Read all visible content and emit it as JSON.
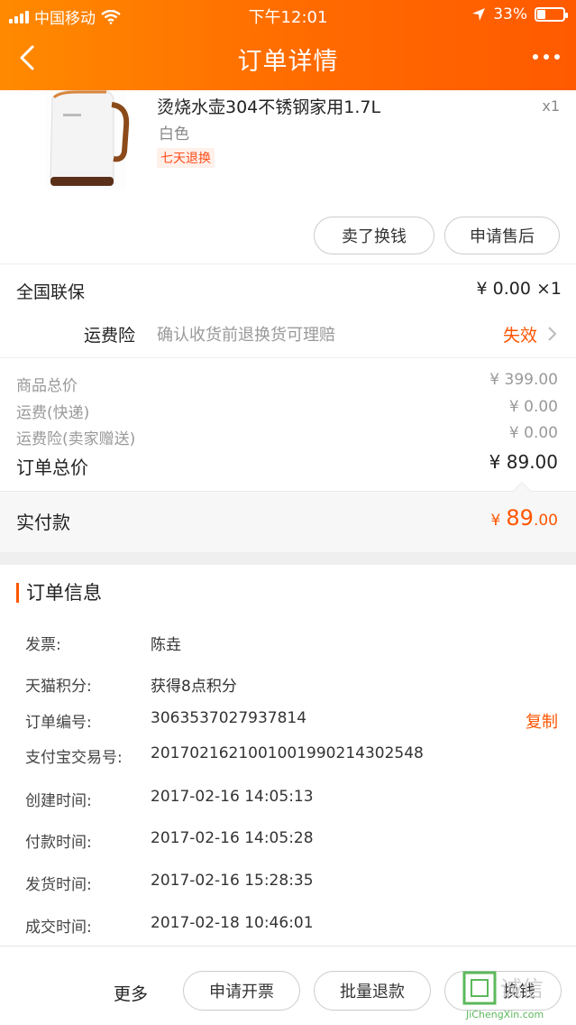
{
  "status_bar": {
    "carrier": "中国移动",
    "time": "下午12:01",
    "battery": "33%",
    "battery_level": 0.33
  },
  "nav": {
    "title": "订单详情"
  },
  "product": {
    "title": "烫烧水壶304不锈钢家用1.7L",
    "quantity": "x1",
    "color": "白色",
    "tag": "七天退换",
    "buttons": {
      "sell": "卖了换钱",
      "after_sale": "申请售后"
    }
  },
  "warranty": {
    "label": "全国联保",
    "price": "¥ 0.00 ×1"
  },
  "shipping_insurance": {
    "label": "运费险",
    "desc": "确认收货前退换货可理赔",
    "status": "失效"
  },
  "pricing": {
    "items": [
      {
        "label": "商品总价",
        "value": "¥ 399.00"
      },
      {
        "label": "运费(快递)",
        "value": "¥ 0.00"
      },
      {
        "label": "运费险(卖家赠送)",
        "value": "¥ 0.00"
      }
    ],
    "total_label": "订单总价",
    "total_value": "¥ 89.00",
    "paid_label": "实付款",
    "paid_symbol": "¥",
    "paid_int": "89",
    "paid_dec": ".00"
  },
  "order_info": {
    "title": "订单信息",
    "rows": [
      {
        "label": "发票:",
        "value": "陈垚"
      },
      {
        "label": "天猫积分:",
        "value": "获得8点积分"
      },
      {
        "label": "订单编号:",
        "value": "3063537027937814"
      },
      {
        "label": "支付宝交易号:",
        "value": "2017021621001001990214302548"
      },
      {
        "label": "创建时间:",
        "value": "2017-02-16 14:05:13"
      },
      {
        "label": "付款时间:",
        "value": "2017-02-16 14:05:28"
      },
      {
        "label": "发货时间:",
        "value": "2017-02-16 15:28:35"
      },
      {
        "label": "成交时间:",
        "value": "2017-02-18 10:46:01"
      }
    ],
    "copy_label": "复制"
  },
  "bottom_bar": {
    "more": "更多",
    "invoice": "申请开票",
    "batch_refund": "批量退款",
    "sell": "换钱"
  },
  "watermark": {
    "text": "JiChengXin.com"
  },
  "colors": {
    "header": "#ff6a00",
    "accent": "#ff5500",
    "tag_bg": "#fff0ea"
  }
}
